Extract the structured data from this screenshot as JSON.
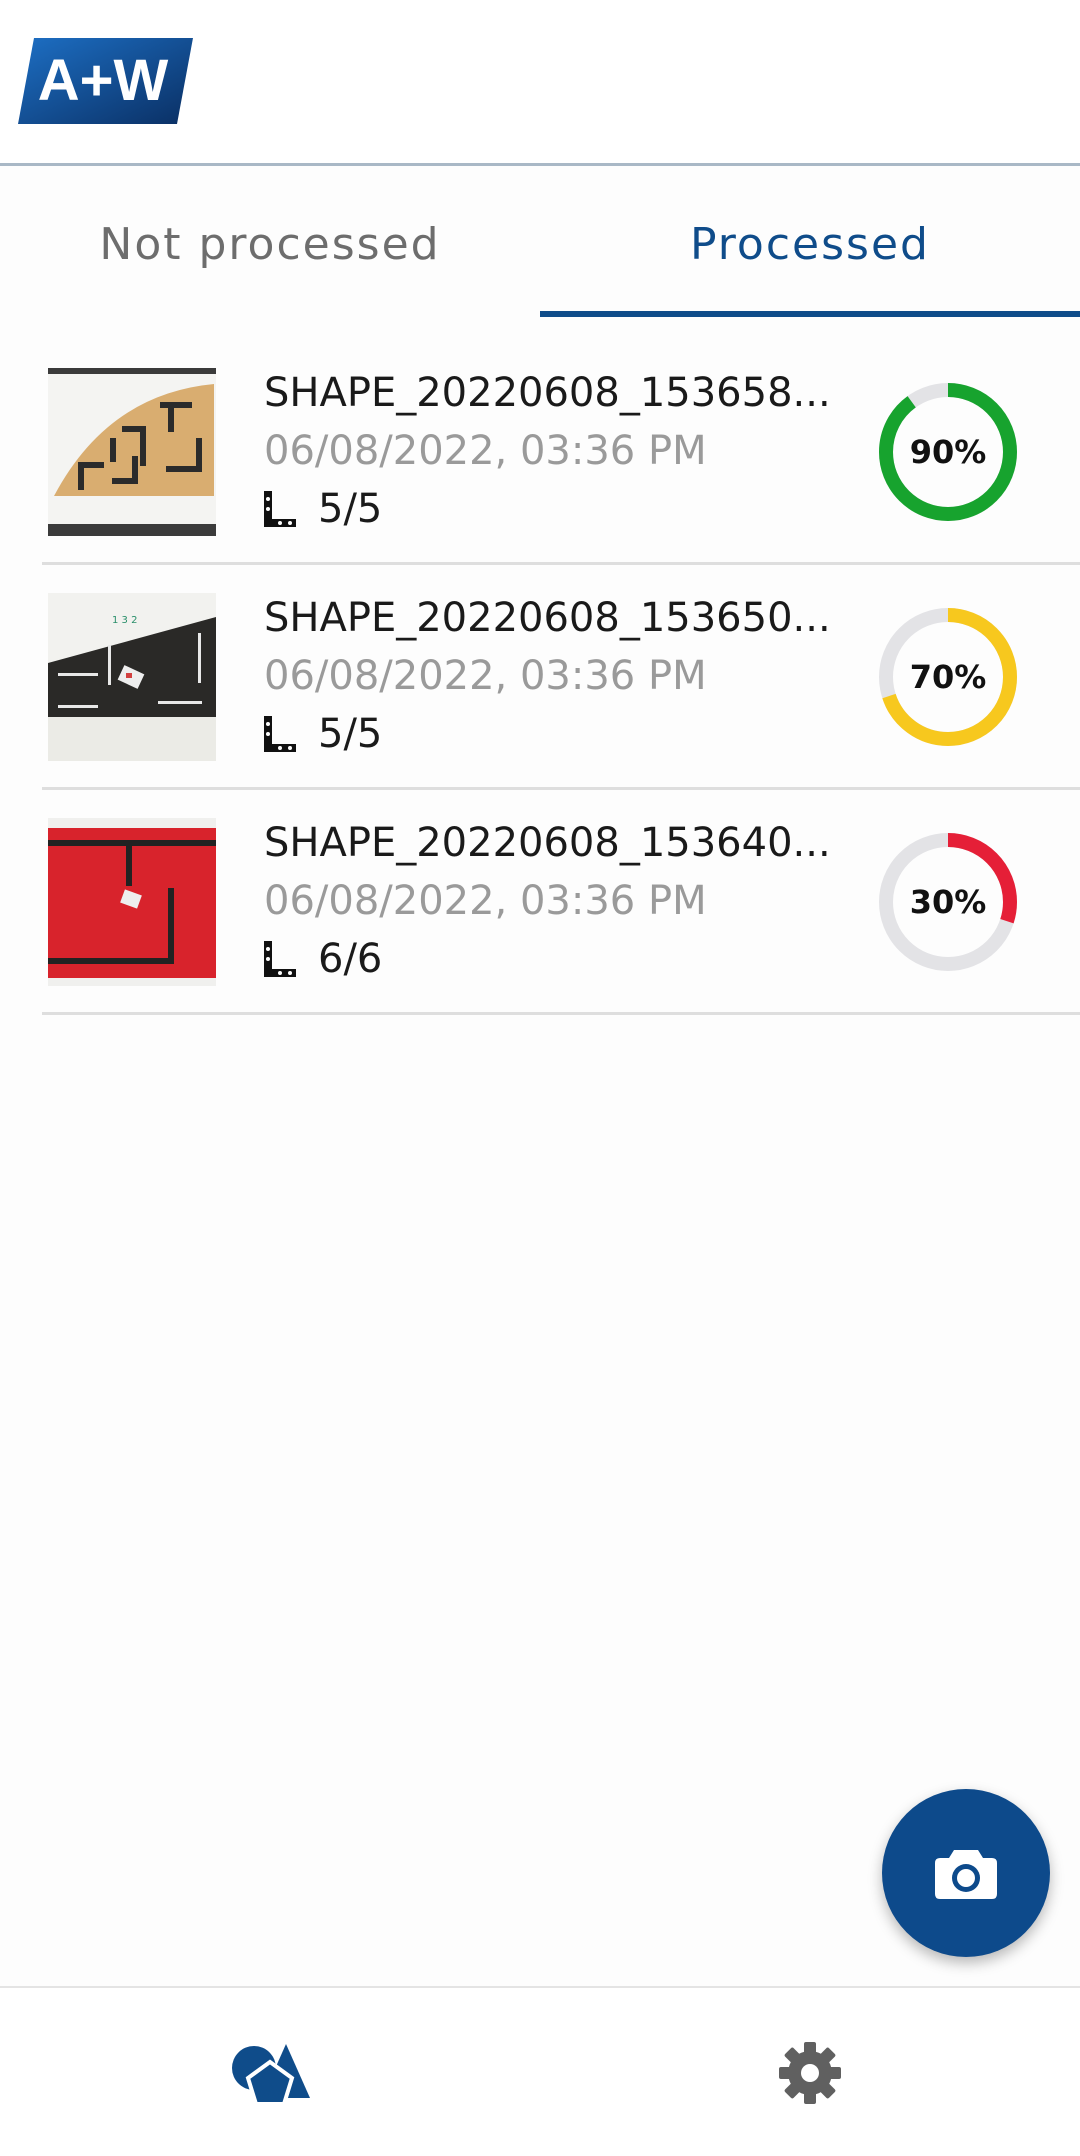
{
  "header": {
    "logo_text": "A+W",
    "brand_color": "#0f4c8a"
  },
  "tabs": [
    {
      "label": "Not processed",
      "active": false
    },
    {
      "label": "Processed",
      "active": true
    }
  ],
  "items": [
    {
      "title": "SHAPE_20220608_153658...",
      "date": "06/08/2022, 03:36 PM",
      "count": "5/5",
      "percent": 90,
      "percent_label": "90%",
      "color": "#17a32e",
      "thumbnail": "beige-quarter-circle-shape"
    },
    {
      "title": "SHAPE_20220608_153650...",
      "date": "06/08/2022, 03:36 PM",
      "count": "5/5",
      "percent": 70,
      "percent_label": "70%",
      "color": "#f7c81e",
      "thumbnail": "black-shape"
    },
    {
      "title": "SHAPE_20220608_153640...",
      "date": "06/08/2022, 03:36 PM",
      "count": "6/6",
      "percent": 30,
      "percent_label": "30%",
      "color": "#e51f37",
      "thumbnail": "red-rectangle-shape"
    }
  ],
  "fab": {
    "icon": "camera-icon"
  },
  "bottom_nav": [
    {
      "icon": "shapes-icon",
      "active": true
    },
    {
      "icon": "gear-icon",
      "active": false
    }
  ],
  "colors": {
    "gauge_track": "#e3e3e6"
  }
}
